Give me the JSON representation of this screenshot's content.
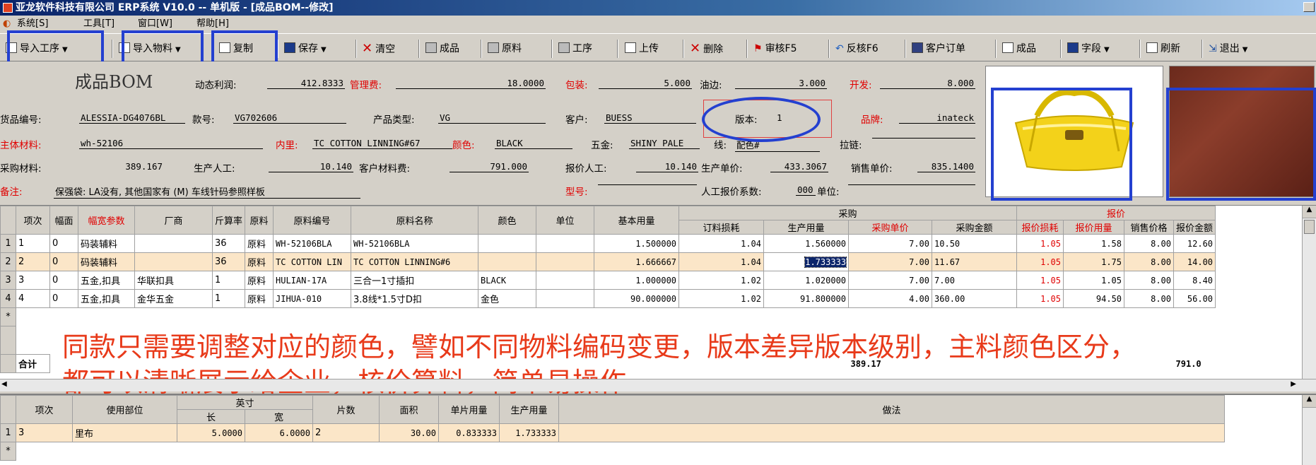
{
  "window": {
    "title": "亚龙软件科技有限公司 ERP系统 V10.0 -- 单机版 - [成品BOM--修改]"
  },
  "menu": [
    {
      "label": "系统[S]"
    },
    {
      "label": "工具[T]"
    },
    {
      "label": "窗口[W]"
    },
    {
      "label": "帮助[H]"
    }
  ],
  "toolbar": {
    "import_process": "导入工序",
    "import_material": "导入物料",
    "copy": "复制",
    "save": "保存",
    "clear": "清空",
    "finished": "成品",
    "material": "原料",
    "process": "工序",
    "upload": "上传",
    "delete": "删除",
    "audit": "审核F5",
    "unaudit": "反核F6",
    "customer_order": "客户订单",
    "finished2": "成品",
    "fields": "字段",
    "refresh": "刷新",
    "exit": "退出"
  },
  "form": {
    "big_title": "成品BOM",
    "profit_label": "动态利润:",
    "profit_value": "412.8333",
    "mgmt_fee_label": "管理费:",
    "mgmt_fee_value": "18.0000",
    "packing_label": "包装:",
    "packing_value": "5.000",
    "oil_edge_label": "油边:",
    "oil_edge_value": "3.000",
    "dev_label": "开发:",
    "dev_value": "8.000",
    "goods_no_label": "货品编号:",
    "goods_no_value": "ALESSIA-DG4076BL",
    "style_no_label": "款号:",
    "style_no_value": "VG702606",
    "product_type_label": "产品类型:",
    "product_type_value": "VG",
    "customer_label": "客户:",
    "customer_value": "BUESS",
    "version_label": "版本:",
    "version_value": "1",
    "brand_label": "品牌:",
    "brand_value": "inateck",
    "main_material_label": "主体材料:",
    "main_material_value": "wh-52106",
    "lining_label": "内里:",
    "lining_value": "TC COTTON LINNING#67",
    "color_label": "颜色:",
    "color_value": "BLACK",
    "hardware_label": "五金:",
    "hardware_value": "SHINY PALE",
    "thread_label": "线:",
    "thread_value": "配色#",
    "zipper_label": "拉链:",
    "purchase_material_label": "采购材料:",
    "purchase_material_value": "389.167",
    "labor_label": "生产人工:",
    "labor_value": "10.140",
    "customer_material_label": "客户材料费:",
    "customer_material_value": "791.000",
    "quote_labor_label": "报价人工:",
    "quote_labor_value": "10.140",
    "unit_price_label": "生产单价:",
    "unit_price_value": "433.3067",
    "sale_price_label": "销售单价:",
    "sale_price_value": "835.1400",
    "remark_label": "备注:",
    "remark_value": "保强袋: LA没有, 其他国家有 (M) 车线针码参照样板",
    "model_label": "型号:",
    "labor_coef_label": "人工报价系数:",
    "labor_coef_value": "000",
    "unit_label": "单位:"
  },
  "grid": {
    "group_purchase": "采购",
    "group_quote": "报价",
    "headers": [
      "项次",
      "幅面",
      "幅宽参数",
      "厂商",
      "斤算率",
      "原料",
      "原料编号",
      "原料名称",
      "颜色",
      "单位",
      "基本用量",
      "订料损耗",
      "生产用量",
      "采购单价",
      "采购金额",
      "报价损耗",
      "报价用量",
      "销售价格",
      "报价金额"
    ],
    "rows": [
      [
        "1",
        "1",
        "0",
        "码装辅料",
        "",
        "36",
        "原料",
        "WH-52106BLA",
        "WH-52106BLA",
        "",
        "",
        "1.500000",
        "1.04",
        "1.560000",
        "7.00",
        "10.50",
        "1.05",
        "1.58",
        "8.00",
        "12.60"
      ],
      [
        "2",
        "2",
        "0",
        "码装辅料",
        "",
        "36",
        "原料",
        "TC COTTON LIN",
        "TC COTTON LINNING#6",
        "",
        "",
        "1.666667",
        "1.04",
        "1.733333",
        "7.00",
        "11.67",
        "1.05",
        "1.75",
        "8.00",
        "14.00"
      ],
      [
        "3",
        "3",
        "0",
        "五金,扣具",
        "华联扣具",
        "1",
        "原料",
        "HULIAN-17A",
        "三合一1寸插扣",
        "BLACK",
        "",
        "1.000000",
        "1.02",
        "1.020000",
        "7.00",
        "7.00",
        "1.05",
        "1.05",
        "8.00",
        "8.40"
      ],
      [
        "4",
        "4",
        "0",
        "五金,扣具",
        "金华五金",
        "1",
        "原料",
        "JIHUA-010",
        "3.8线*1.5寸D扣",
        "金色",
        "",
        "90.000000",
        "1.02",
        "91.800000",
        "4.00",
        "360.00",
        "1.05",
        "94.50",
        "8.00",
        "56.00"
      ]
    ],
    "new_row_marker": "*",
    "total_label": "合计",
    "total_purchase": "389.17",
    "total_quote": "791.0"
  },
  "overlay": {
    "line1": "同款只需要调整对应的颜色，譬如不同物料编码变更，版本差异版本级别，主料颜色区分，",
    "line2": "都可以清晰展示给企业，核价算料，简单易操作"
  },
  "grid2": {
    "headers": [
      "项次",
      "使用部位",
      "英寸",
      "长",
      "宽",
      "片数",
      "面积",
      "单片用量",
      "生产用量",
      "做法"
    ],
    "rows": [
      [
        "1",
        "3",
        "里布",
        "5.0000",
        "6.0000",
        "2",
        "30.00",
        "0.833333",
        "1.733333",
        ""
      ]
    ],
    "new_row_marker": "*"
  },
  "colors": {
    "accent": "#2440d0",
    "overlay_text": "#e83a1a",
    "label_red": "#e00000",
    "row_highlight": "#fbe6c8"
  }
}
